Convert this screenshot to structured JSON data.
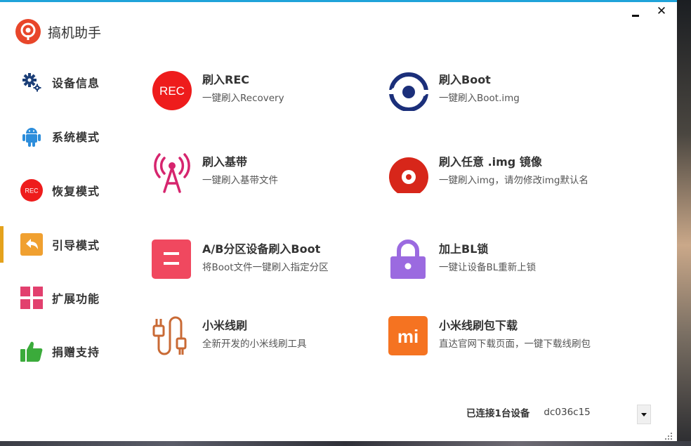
{
  "window": {
    "minimize_glyph": "",
    "close_glyph": "✕",
    "app_title": "搞机助手",
    "accent_color": "#1fa3d9"
  },
  "sidebar": {
    "active_color": "#e4a21c",
    "items": [
      {
        "label": "设备信息",
        "icon": "gears-icon"
      },
      {
        "label": "系统模式",
        "icon": "android-icon"
      },
      {
        "label": "恢复模式",
        "icon": "rec-icon",
        "icon_text": "REC"
      },
      {
        "label": "引导模式",
        "icon": "reply-arrow-icon",
        "active": true
      },
      {
        "label": "扩展功能",
        "icon": "grid-icon"
      },
      {
        "label": "捐赠支持",
        "icon": "thumbs-up-icon"
      }
    ]
  },
  "cards": [
    {
      "title": "刷入REC",
      "desc": "一键刷入Recovery",
      "icon": "rec-icon",
      "icon_text": "REC",
      "color": "#ee1c1c"
    },
    {
      "title": "刷入Boot",
      "desc": "一键刷入Boot.img",
      "icon": "boot-icon",
      "color": "#1b2f7a"
    },
    {
      "title": "刷入基带",
      "desc": "一键刷入基带文件",
      "icon": "antenna-tower-icon",
      "color": "#d6256e"
    },
    {
      "title": "刷入任意 .img 镜像",
      "desc": "一键刷入img，请勿修改img默认名",
      "icon": "disc-icon",
      "color": "#d7261a"
    },
    {
      "title": "A/B分区设备刷入Boot",
      "desc": "将Boot文件一键刷入指定分区",
      "icon": "partition-icon",
      "color": "#f0485f"
    },
    {
      "title": "加上BL锁",
      "desc": "一键让设备BL重新上锁",
      "icon": "lock-icon",
      "color": "#9b6ae0"
    },
    {
      "title": "小米线刷",
      "desc": "全新开发的小米线刷工具",
      "icon": "usb-cable-icon",
      "color": "#c96a35"
    },
    {
      "title": "小米线刷包下载",
      "desc": "直达官网下载页面，一键下载线刷包",
      "icon": "mi-logo-icon",
      "icon_text": "mi",
      "color": "#f57321"
    }
  ],
  "status": {
    "connected_label": "已连接1台设备",
    "device_id": "dc036c15"
  }
}
